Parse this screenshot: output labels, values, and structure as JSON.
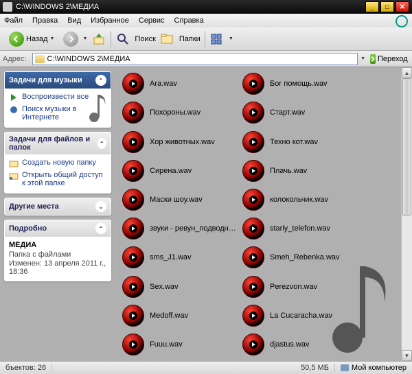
{
  "window": {
    "title": "C:\\WINDOWS 2\\МЕДИА"
  },
  "menu": {
    "file": "Файл",
    "edit": "Правка",
    "view": "Вид",
    "favorites": "Избранное",
    "tools": "Сервис",
    "help": "Справка"
  },
  "toolbar": {
    "back": "Назад",
    "search": "Поиск",
    "folders": "Папки"
  },
  "address": {
    "label": "Адрес:",
    "path": "C:\\WINDOWS 2\\МЕДИА",
    "go": "Переход"
  },
  "sidebar": {
    "music": {
      "title": "Задачи для музыки",
      "play_all": "Воспроизвести все",
      "find_online": "Поиск музыки в Интернете"
    },
    "files": {
      "title": "Задачи для файлов и папок",
      "new_folder": "Создать новую папку",
      "share": "Открыть общий доступ к этой папке"
    },
    "places": {
      "title": "Другие места"
    },
    "details": {
      "title": "Подробно",
      "name": "МЕДИА",
      "type": "Папка с файлами",
      "modified_label": "Изменен:",
      "modified_value": "13 апреля 2011 г., 18:36"
    }
  },
  "files_col1": [
    "Ага.wav",
    "Похороны.wav",
    "Хор животных.wav",
    "Сирена.wav",
    "Маски шоу.wav",
    "звуки - ревун_подводной_лод...",
    "sms_J1.wav",
    "Sex.wav",
    "Medoff.wav",
    "Fuuu.wav"
  ],
  "files_col2": [
    "Бог помощь.wav",
    "Старт.wav",
    "Техно кот.wav",
    "Плачь.wav",
    "колокольчик.wav",
    "stariy_telefon.wav",
    "Smeh_Rebenka.wav",
    "Perezvon.wav",
    "La Cucaracha.wav",
    "djastus.wav"
  ],
  "status": {
    "objects_label": "бъектов:",
    "objects_count": "26",
    "size": "50,5 МБ",
    "location": "Мой компьютер"
  }
}
